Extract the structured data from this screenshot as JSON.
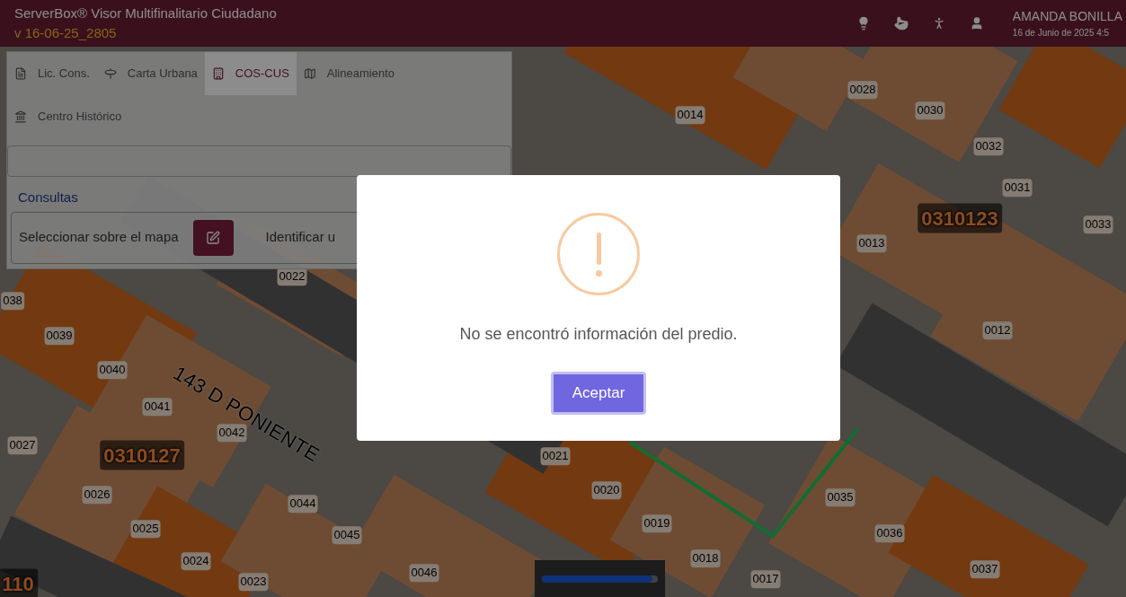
{
  "header": {
    "title": "ServerBox® Visor Multifinalitario Ciudadano",
    "version": "v 16-06-25_2805",
    "user": "AMANDA BONILLA",
    "datetime": "16 de Junio de 2025 4:5"
  },
  "panel": {
    "tabs": [
      {
        "label": "Lic. Cons.",
        "selected": false
      },
      {
        "label": "Carta Urbana",
        "selected": false
      },
      {
        "label": "COS-CUS",
        "selected": true
      },
      {
        "label": "Alineamiento",
        "selected": false
      },
      {
        "label": "Centro Histórico",
        "selected": false
      }
    ],
    "section_title": "Consultas",
    "select_label": "Seleccionar sobre el mapa",
    "identify_label": "Identificar u"
  },
  "map": {
    "street": "143 D PONIENTE",
    "labels": [
      {
        "text": "0014",
        "kind": "parcel"
      },
      {
        "text": "0028",
        "kind": "parcel"
      },
      {
        "text": "0030",
        "kind": "parcel"
      },
      {
        "text": "0032",
        "kind": "parcel"
      },
      {
        "text": "0031",
        "kind": "parcel"
      },
      {
        "text": "0033",
        "kind": "parcel"
      },
      {
        "text": "0310123",
        "kind": "block"
      },
      {
        "text": "0013",
        "kind": "parcel"
      },
      {
        "text": "0012",
        "kind": "parcel"
      },
      {
        "text": "0022",
        "kind": "parcel"
      },
      {
        "text": "038",
        "kind": "parcel"
      },
      {
        "text": "0039",
        "kind": "parcel"
      },
      {
        "text": "0040",
        "kind": "parcel"
      },
      {
        "text": "0041",
        "kind": "parcel"
      },
      {
        "text": "0042",
        "kind": "parcel"
      },
      {
        "text": "0310127",
        "kind": "block"
      },
      {
        "text": "0027",
        "kind": "parcel"
      },
      {
        "text": "0026",
        "kind": "parcel"
      },
      {
        "text": "0025",
        "kind": "parcel"
      },
      {
        "text": "0044",
        "kind": "parcel"
      },
      {
        "text": "0045",
        "kind": "parcel"
      },
      {
        "text": "0024",
        "kind": "parcel"
      },
      {
        "text": "0023",
        "kind": "parcel"
      },
      {
        "text": "0046",
        "kind": "parcel"
      },
      {
        "text": "0021",
        "kind": "parcel"
      },
      {
        "text": "0020",
        "kind": "parcel"
      },
      {
        "text": "0019",
        "kind": "parcel"
      },
      {
        "text": "0018",
        "kind": "parcel"
      },
      {
        "text": "0017",
        "kind": "parcel"
      },
      {
        "text": "0035",
        "kind": "parcel"
      },
      {
        "text": "0036",
        "kind": "parcel"
      },
      {
        "text": "0037",
        "kind": "parcel"
      },
      {
        "text": "110",
        "kind": "block"
      }
    ]
  },
  "modal": {
    "message": "No se encontró información del predio.",
    "button": "Aceptar"
  },
  "opacity_slider": {
    "level": 0.95
  }
}
